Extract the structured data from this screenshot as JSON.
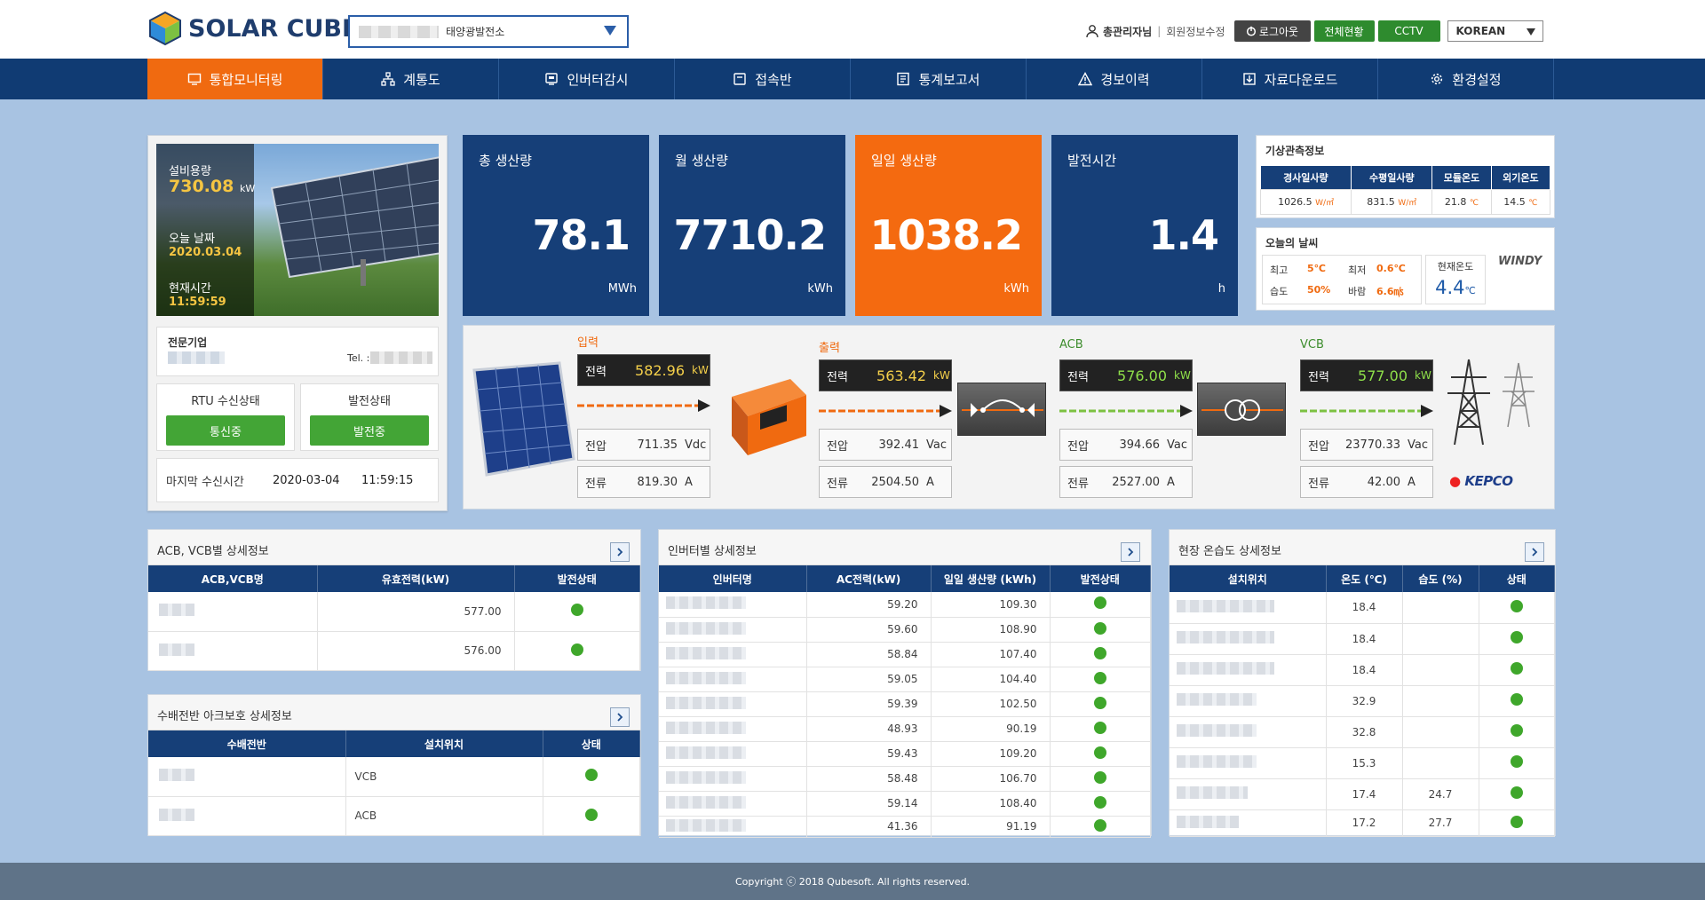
{
  "header": {
    "logo_text": "SOLAR CUBE",
    "plant_name": "태양광발전소",
    "admin_name": "총관리자님",
    "member_edit": "회원정보수정",
    "logout": "로그아웃",
    "overall": "전체현황",
    "cctv": "CCTV",
    "language": "KOREAN"
  },
  "nav": [
    {
      "label": "통합모니터링",
      "icon": "monitor-icon",
      "active": true
    },
    {
      "label": "계통도",
      "icon": "network-icon"
    },
    {
      "label": "인버터감시",
      "icon": "inverter-icon"
    },
    {
      "label": "접속반",
      "icon": "junction-box-icon"
    },
    {
      "label": "통계보고서",
      "icon": "report-icon"
    },
    {
      "label": "경보이력",
      "icon": "warning-icon"
    },
    {
      "label": "자료다운로드",
      "icon": "download-icon"
    },
    {
      "label": "환경설정",
      "icon": "gear-icon"
    }
  ],
  "site": {
    "capacity_label": "설비용량",
    "capacity_value": "730.08",
    "capacity_unit": "kW",
    "date_label": "오늘 날짜",
    "date_value": "2020.03.04",
    "time_label": "현재시간",
    "time_value": "11:59:59",
    "company_label": "전문기업",
    "tel_label": "Tel. :",
    "rtu_label": "RTU 수신상태",
    "rtu_status": "통신중",
    "gen_label": "발전상태",
    "gen_status": "발전중",
    "last_recv_label": "마지막 수신시간",
    "last_recv_date": "2020-03-04",
    "last_recv_time": "11:59:15"
  },
  "kpi": {
    "total": {
      "title": "총 생산량",
      "value": "78.1",
      "unit": "MWh"
    },
    "month": {
      "title": "월 생산량",
      "value": "7710.2",
      "unit": "kWh"
    },
    "day": {
      "title": "일일 생산량",
      "value": "1038.2",
      "unit": "kWh"
    },
    "hours": {
      "title": "발전시간",
      "value": "1.4",
      "unit": "h"
    }
  },
  "weather_obs": {
    "title": "기상관측정보",
    "headers": [
      "경사일사량",
      "수평일사량",
      "모듈온도",
      "외기온도"
    ],
    "values": [
      "1026.5",
      "831.5",
      "21.8",
      "14.5"
    ],
    "units": [
      "W/㎡",
      "W/㎡",
      "℃",
      "℃"
    ]
  },
  "today_weather": {
    "title": "오늘의 날씨",
    "high_label": "최고",
    "high": "5℃",
    "low_label": "최저",
    "low": "0.6℃",
    "humid_label": "습도",
    "humid": "50%",
    "wind_label": "바람",
    "wind": "6.6㎧",
    "cur_label": "현재온도",
    "cur": "4.4",
    "cur_unit": "℃",
    "provider": "WINDY"
  },
  "flow": {
    "power_label": "전력",
    "voltage_label": "전압",
    "current_label": "전류",
    "input": {
      "label": "입력",
      "power": "582.96",
      "power_unit": "kW",
      "voltage": "711.35",
      "voltage_unit": "Vdc",
      "current": "819.30",
      "current_unit": "A"
    },
    "output": {
      "label": "출력",
      "power": "563.42",
      "power_unit": "kW",
      "voltage": "392.41",
      "voltage_unit": "Vac",
      "current": "2504.50",
      "current_unit": "A"
    },
    "acb": {
      "label": "ACB",
      "power": "576.00",
      "power_unit": "kW",
      "voltage": "394.66",
      "voltage_unit": "Vac",
      "current": "2527.00",
      "current_unit": "A"
    },
    "vcb": {
      "label": "VCB",
      "power": "577.00",
      "power_unit": "kW",
      "voltage": "23770.33",
      "voltage_unit": "Vac",
      "current": "42.00",
      "current_unit": "A"
    },
    "utility": "KEPCO"
  },
  "acb_table": {
    "title": "ACB, VCB별 상세정보",
    "headers": [
      "ACB,VCB명",
      "유효전력(kW)",
      "발전상태"
    ],
    "rows": [
      {
        "power": "577.00"
      },
      {
        "power": "576.00"
      }
    ]
  },
  "arc_table": {
    "title": "수배전반 아크보호 상세정보",
    "headers": [
      "수배전반",
      "설치위치",
      "상태"
    ],
    "rows": [
      {
        "loc": "VCB"
      },
      {
        "loc": "ACB"
      }
    ]
  },
  "inv_table": {
    "title": "인버터별 상세정보",
    "headers": [
      "인버터명",
      "AC전력(kW)",
      "일일 생산량 (kWh)",
      "발전상태"
    ],
    "rows": [
      {
        "ac": "59.20",
        "daily": "109.30"
      },
      {
        "ac": "59.60",
        "daily": "108.90"
      },
      {
        "ac": "58.84",
        "daily": "107.40"
      },
      {
        "ac": "59.05",
        "daily": "104.40"
      },
      {
        "ac": "59.39",
        "daily": "102.50"
      },
      {
        "ac": "48.93",
        "daily": "90.19"
      },
      {
        "ac": "59.43",
        "daily": "109.20"
      },
      {
        "ac": "58.48",
        "daily": "106.70"
      },
      {
        "ac": "59.14",
        "daily": "108.40"
      },
      {
        "ac": "41.36",
        "daily": "91.19"
      }
    ]
  },
  "env_table": {
    "title": "현장 온습도 상세정보",
    "headers": [
      "설치위치",
      "온도 (℃)",
      "습도 (%)",
      "상태"
    ],
    "rows": [
      {
        "temp": "18.4",
        "humid": ""
      },
      {
        "temp": "18.4",
        "humid": ""
      },
      {
        "temp": "18.4",
        "humid": ""
      },
      {
        "temp": "32.9",
        "humid": ""
      },
      {
        "temp": "32.8",
        "humid": ""
      },
      {
        "temp": "15.3",
        "humid": ""
      },
      {
        "temp": "17.4",
        "humid": "24.7"
      },
      {
        "temp": "17.2",
        "humid": "27.7"
      }
    ]
  },
  "footer": "Copyright ⓒ 2018 Qubesoft. All rights reserved."
}
